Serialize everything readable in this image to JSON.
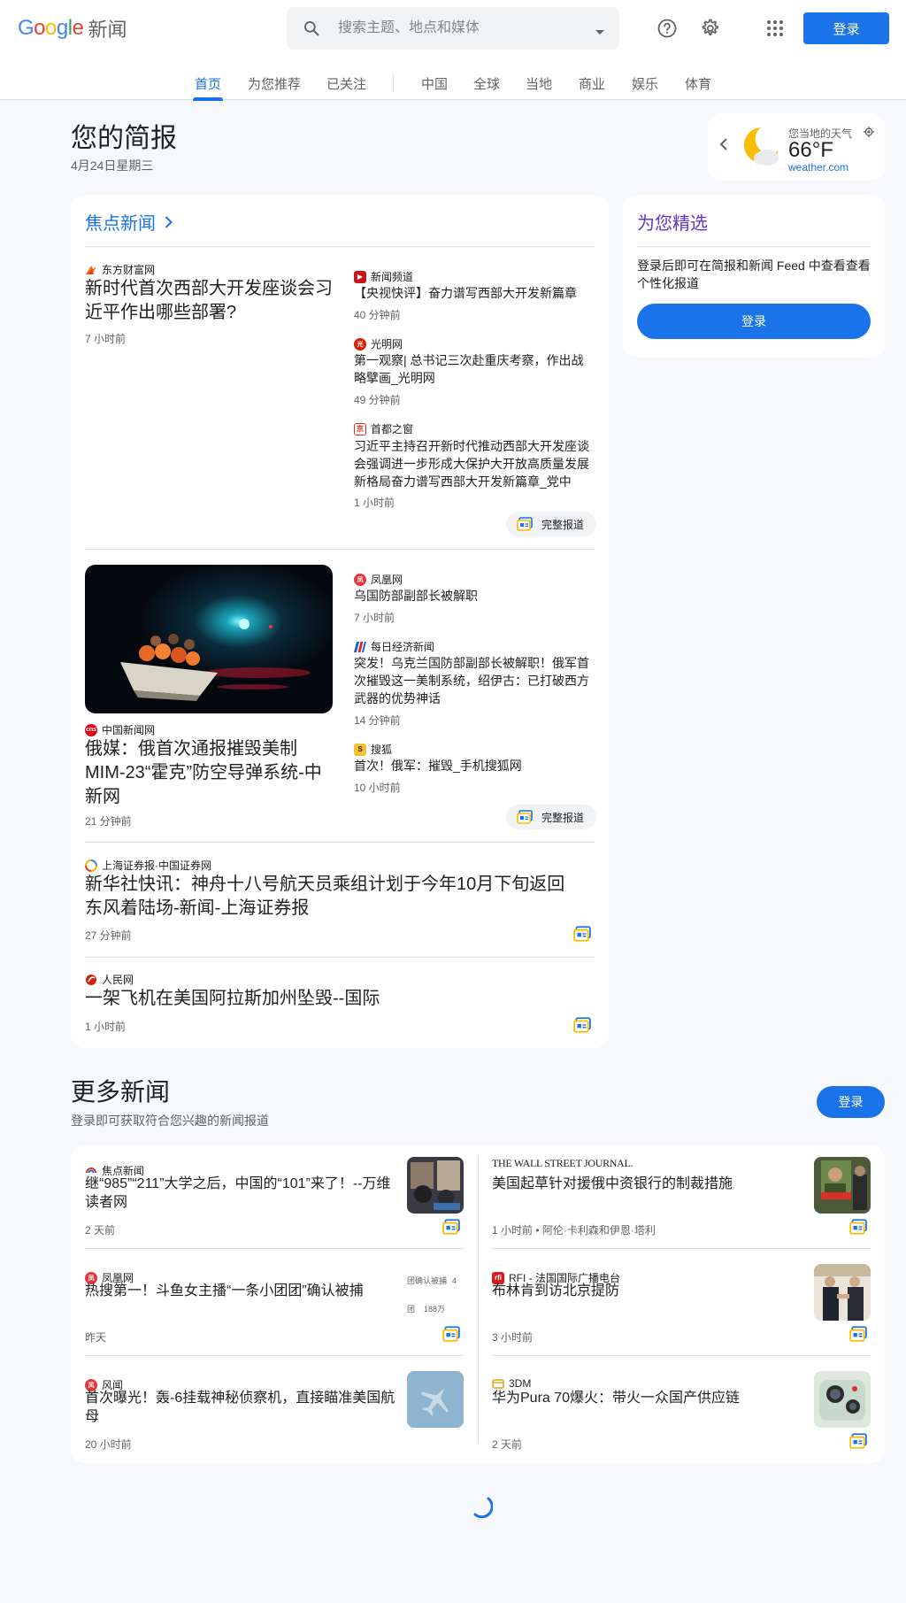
{
  "header": {
    "logo_google": "Google",
    "logo_news": "新闻",
    "search_placeholder": "搜索主题、地点和媒体",
    "login": "登录"
  },
  "tabs": [
    "首页",
    "为您推荐",
    "已关注",
    "中国",
    "全球",
    "当地",
    "商业",
    "娱乐",
    "体育"
  ],
  "briefing": {
    "title": "您的简报",
    "date": "4月24日星期三"
  },
  "weather": {
    "label": "您当地的天气",
    "temp": "66°F",
    "source": "weather.com"
  },
  "focus": {
    "title": "焦点新闻",
    "full_coverage": "完整报道",
    "cluster1": {
      "main": {
        "source": "东方财富网",
        "title": "新时代首次西部大开发座谈会习近平作出哪些部署?",
        "time": "7 小时前"
      },
      "side": [
        {
          "source": "新闻频道",
          "title": "【央视快评】奋力谱写西部大开发新篇章",
          "time": "40 分钟前"
        },
        {
          "source": "光明网",
          "title": "第一观察| 总书记三次赴重庆考察，作出战略擘画_光明网",
          "time": "49 分钟前"
        },
        {
          "source": "首都之窗",
          "title": "习近平主持召开新时代推动西部大开发座谈会强调进一步形成大保护大开放高质量发展新格局奋力谱写西部大开发新篇章_党中央…",
          "time": "1 小时前"
        }
      ]
    },
    "cluster2": {
      "main": {
        "source": "中国新闻网",
        "title": "俄媒：俄首次通报摧毁美制MIM-23“霍克”防空导弹系统-中新网",
        "time": "21 分钟前"
      },
      "side": [
        {
          "source": "凤凰网",
          "title": "乌国防部副部长被解职",
          "time": "7 小时前"
        },
        {
          "source": "每日经济新闻",
          "title": "突发！乌克兰国防部副部长被解职！俄军首次摧毁这一美制系统，绍伊古：已打破西方武器的优势神话",
          "time": "14 分钟前"
        },
        {
          "source": "搜狐",
          "title": "首次！俄军：摧毁_手机搜狐网",
          "time": "10 小时前"
        }
      ]
    },
    "single1": {
      "source": "上海证券报·中国证券网",
      "title": "新华社快讯：神舟十八号航天员乘组计划于今年10月下旬返回东风着陆场-新闻-上海证券报",
      "time": "27 分钟前"
    },
    "single2": {
      "source": "人民网",
      "title": "一架飞机在美国阿拉斯加州坠毁--国际",
      "time": "1 小时前"
    }
  },
  "picks": {
    "title": "为您精选",
    "text": "登录后即可在简报和新闻 Feed 中查看查看个性化报道",
    "button": "登录"
  },
  "more": {
    "title": "更多新闻",
    "subtitle": "登录即可获取符合您兴趣的新闻报道",
    "button": "登录",
    "left": [
      {
        "source": "焦点新闻",
        "title": "继“985”“211”大学之后，中国的“101”来了！--万维读者网",
        "time": "2 天前"
      },
      {
        "source": "凤凰网",
        "title": "热搜第一！斗鱼女主播“一条小团团”确认被捕",
        "time": "昨天",
        "thumb_text1": "团确认被捕",
        "thumb_num": "4",
        "thumb_text2": "团",
        "thumb_num2": "188万"
      },
      {
        "source": "风闻",
        "title": "首次曝光！轰-6挂载神秘侦察机，直接瞄准美国航母",
        "time": "20 小时前"
      }
    ],
    "right": [
      {
        "source": "THE WALL STREET JOURNAL.",
        "title": "美国起草针对援俄中资银行的制裁措施",
        "time": "1 小时前 • 阿伦·卡利森和伊恩·塔利"
      },
      {
        "source": "RFI - 法国国际广播电台",
        "title": "布林肯到访北京提防",
        "time": "3 小时前"
      },
      {
        "source": "3DM",
        "title": "华为Pura 70爆火：带火一众国产供应链",
        "time": "2 天前"
      }
    ]
  },
  "colors": {
    "accent": "#1a73e8",
    "purple": "#6235d0",
    "bg": "#f6f8fc"
  }
}
